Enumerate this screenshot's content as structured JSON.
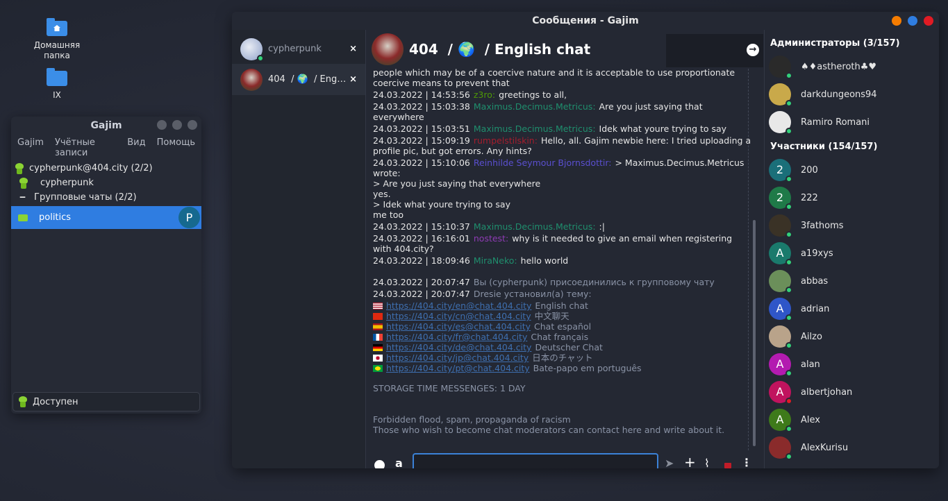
{
  "desktop": {
    "icons": [
      {
        "label": "Домашняя папка"
      },
      {
        "label": "IX"
      }
    ]
  },
  "roster": {
    "title": "Gajim",
    "menu": [
      "Gajim",
      "Учётные записи",
      "Вид",
      "Помощь"
    ],
    "account": "cypherpunk@404.city (2/2)",
    "contact": "cypherpunk",
    "group": "Групповые чаты (2/2)",
    "selected": {
      "label": "politics",
      "badge": "P"
    },
    "status": "Доступен"
  },
  "chatwin": {
    "title": "Сообщения - Gajim",
    "window_buttons": {
      "minimize_color": "#f57c00",
      "maximize_color": "#2f7de1",
      "close_color": "#e01b24"
    }
  },
  "tabs": [
    {
      "label": "cypherpunk",
      "close": "×"
    },
    {
      "label": "404  / 🌍  / Eng…",
      "close": "×"
    }
  ],
  "chat": {
    "header": "404  / 🌍  / English chat",
    "messages": [
      {
        "ts": "",
        "nick": "",
        "text": "people which may be of a coercive nature and it is acceptable to use proportionate coercive means to prevent that",
        "nick_color": "#e6e6e6"
      },
      {
        "ts": "24.03.2022 | 14:53:56",
        "nick": "z3ro:",
        "text": "greetings to all,",
        "nick_color": "#4e9a06"
      },
      {
        "ts": "24.03.2022 | 15:03:38",
        "nick": "Maximus.Decimus.Metricus:",
        "text": "Are you just saying that everywhere",
        "nick_color": "#1f8f6e"
      },
      {
        "ts": "24.03.2022 | 15:03:51",
        "nick": "Maximus.Decimus.Metricus:",
        "text": "Idek what youre trying to say",
        "nick_color": "#1f8f6e"
      },
      {
        "ts": "24.03.2022 | 15:09:19",
        "nick": "rumpelstilskin:",
        "text": "Hello, all. Gajim newbie here: I tried uploading a profile pic, but got errors. Any hints?",
        "nick_color": "#a51d2d"
      },
      {
        "ts": "24.03.2022 | 15:10:06",
        "nick": "Reinhilde Seymour Bjornsdottir:",
        "text": "> Maximus.Decimus.Metricus wrote:\n> Are you just saying that everywhere\nyes.\n> Idek what youre trying to say\nme too",
        "nick_color": "#5a4fcf"
      },
      {
        "ts": "24.03.2022 | 15:10:37",
        "nick": "Maximus.Decimus.Metricus:",
        "text": ":|",
        "nick_color": "#1f8f6e"
      },
      {
        "ts": "24.03.2022 | 16:16:01",
        "nick": "nostest:",
        "text": "why is it needed to give an email when registering with 404.city?",
        "nick_color": "#8f3bb5"
      },
      {
        "ts": "24.03.2022 | 18:09:46",
        "nick": "MiraNeko:",
        "text": "hello world",
        "nick_color": "#1f8f6e"
      }
    ],
    "system": [
      {
        "ts": "24.03.2022 | 20:07:47",
        "text": "Вы (cypherpunk) присоединились к групповому чату"
      },
      {
        "ts": "24.03.2022 | 20:07:47",
        "text": "Dresie установил(а) тему:"
      }
    ],
    "links": [
      {
        "flag": "us",
        "url": "https://404.city/en@chat.404.city",
        "label": "English chat"
      },
      {
        "flag": "cn",
        "url": "https://404.city/cn@chat.404.city",
        "label": "中文聊天"
      },
      {
        "flag": "es",
        "url": "https://404.city/es@chat.404.city",
        "label": "Chat español"
      },
      {
        "flag": "fr",
        "url": "https://404.city/fr@chat.404.city",
        "label": "Chat français"
      },
      {
        "flag": "de",
        "url": "https://404.city/de@chat.404.city",
        "label": "Deutscher Chat"
      },
      {
        "flag": "jp",
        "url": "https://404.city/jp@chat.404.city",
        "label": "日本のチャット"
      },
      {
        "flag": "br",
        "url": "https://404.city/pt@chat.404.city",
        "label": "Bate-papo em português"
      }
    ],
    "storage": "STORAGE TIME MESSENGES:  1 DAY",
    "rules": [
      "Forbidden flood, spam, propaganda of racism",
      "Those who wish to become chat moderators can contact here and write about it."
    ],
    "input_value": ""
  },
  "members": {
    "admins_title": "Администраторы (3/157)",
    "admins": [
      {
        "name": "♠♦astheroth♣♥",
        "color": "#2a2a2a",
        "letter": ""
      },
      {
        "name": "darkdungeons94",
        "color": "#c9a94a",
        "letter": ""
      },
      {
        "name": "Ramiro Romani",
        "color": "#e8e8e8",
        "letter": ""
      }
    ],
    "participants_title": "Участники (154/157)",
    "participants": [
      {
        "name": "200",
        "color": "#1a6f79",
        "letter": "2",
        "status": "#33d17a"
      },
      {
        "name": "222",
        "color": "#1f7a48",
        "letter": "2",
        "status": "#33d17a"
      },
      {
        "name": "3fathoms",
        "color": "#3a3226",
        "letter": "",
        "status": "#33d17a"
      },
      {
        "name": "a19xys",
        "color": "#1a7a6c",
        "letter": "A",
        "status": "#33d17a"
      },
      {
        "name": "abbas",
        "color": "#6b8f5a",
        "letter": "",
        "status": "#33d17a"
      },
      {
        "name": "adrian",
        "color": "#2f56c8",
        "letter": "A",
        "status": "#33d17a"
      },
      {
        "name": "Ailzo",
        "color": "#b9a38a",
        "letter": "",
        "status": "#33d17a"
      },
      {
        "name": "alan",
        "color": "#b31bb0",
        "letter": "A",
        "status": "#33d17a"
      },
      {
        "name": "albertjohan",
        "color": "#c0135e",
        "letter": "A",
        "status": "#e01b24"
      },
      {
        "name": "Alex",
        "color": "#3e7a1a",
        "letter": "A",
        "status": "#33d17a"
      },
      {
        "name": "AlexKurisu",
        "color": "#8a2b2b",
        "letter": "",
        "status": "#33d17a"
      }
    ]
  }
}
